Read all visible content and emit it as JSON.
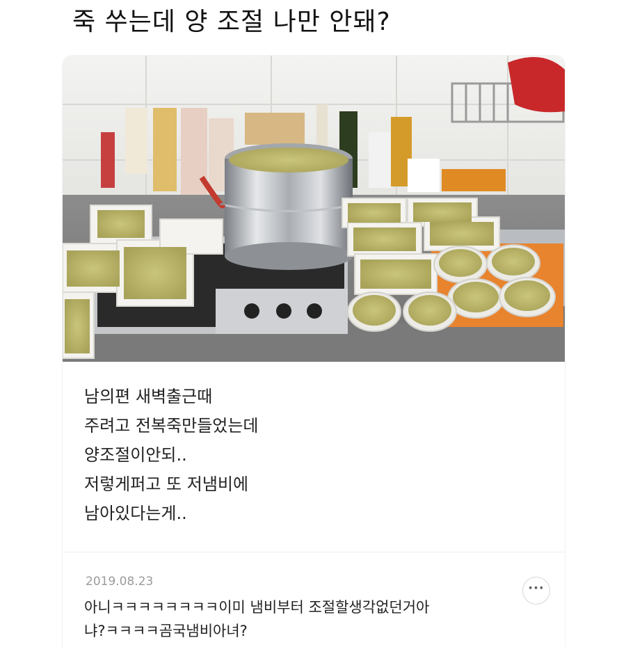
{
  "page": {
    "title": "죽 쑤는데 양 조절 나만 안돼?"
  },
  "post": {
    "body_lines": [
      "남의편 새벽출근때",
      "주려고 전복죽만들었는데",
      "양조절이안되..",
      "저렇게퍼고 또 저냄비에",
      "남아있다는게.."
    ]
  },
  "comment": {
    "date": "2019.08.23",
    "text_lines": [
      "아니ㅋㅋㅋㅋㅋㅋㅋㅋ이미 냄비부터 조절할생각없던거아",
      "냐?ㅋㅋㅋㅋ곰국냄비아녀?"
    ],
    "more_label": "···"
  },
  "photo_icon": "kitchen-porridge-photo"
}
